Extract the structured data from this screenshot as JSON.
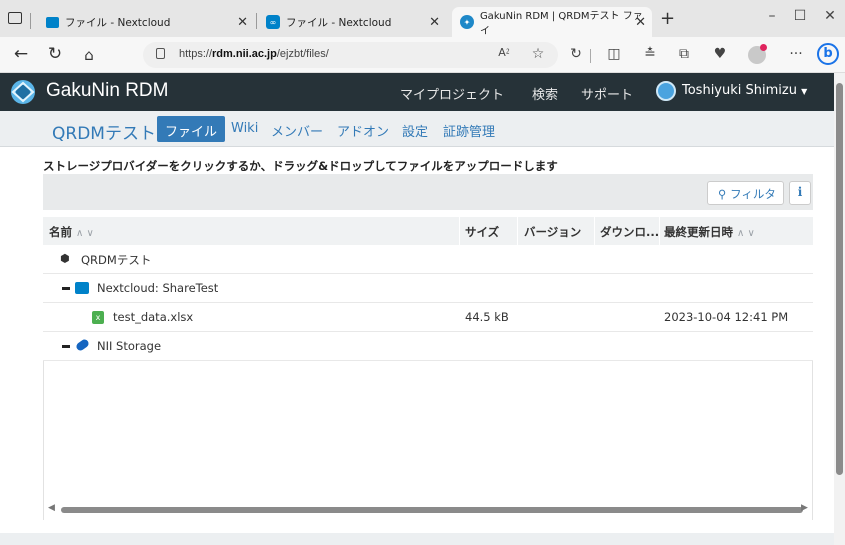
{
  "browser": {
    "tabs": [
      {
        "title": "ファイル - Nextcloud",
        "icon": "nextcloud-icon"
      },
      {
        "title": "ファイル - Nextcloud",
        "icon": "nextcloud-icon"
      },
      {
        "title": "GakuNin RDM | QRDMテスト ファイ",
        "icon": "gakunin-icon",
        "active": true
      }
    ],
    "new_tab": "+",
    "url_prefix": "https://",
    "url_host": "rdm.nii.ac.jp",
    "url_path": "/ejzbt/files/",
    "reader_label": "A⁲",
    "more": "···"
  },
  "navbar": {
    "brand": "GakuNin RDM",
    "links": [
      "マイプロジェクト",
      "検索",
      "サポート"
    ],
    "user": "Toshiyuki Shimizu"
  },
  "project_nav": {
    "title": "QRDMテスト",
    "active": "ファイル",
    "links": [
      "Wiki",
      "メンバー",
      "アドオン",
      "設定",
      "証跡管理"
    ]
  },
  "files": {
    "instructions": "ストレージプロバイダーをクリックするか、ドラッグ&ドロップしてファイルをアップロードします",
    "filter_label": "フィルタ",
    "info_label": "i",
    "columns": {
      "name": "名前",
      "size": "サイズ",
      "version": "バージョン",
      "downloads": "ダウンロ...",
      "modified": "最終更新日時"
    },
    "rows": [
      {
        "name": "QRDMテスト",
        "size": "",
        "modified": "",
        "icon": "cube-icon"
      },
      {
        "name": "Nextcloud: ShareTest",
        "size": "",
        "modified": "",
        "icon": "nextcloud-icon"
      },
      {
        "name": "test_data.xlsx",
        "size": "44.5 kB",
        "modified": "2023-10-04 12:41 PM",
        "icon": "excel-icon"
      },
      {
        "name": "NII Storage",
        "size": "",
        "modified": "",
        "icon": "nii-storage-icon"
      }
    ]
  },
  "colors": {
    "navbar_bg": "#263238",
    "accent": "#337ab7",
    "excel_green": "#4caf50",
    "nextcloud_blue": "#0082c9"
  }
}
